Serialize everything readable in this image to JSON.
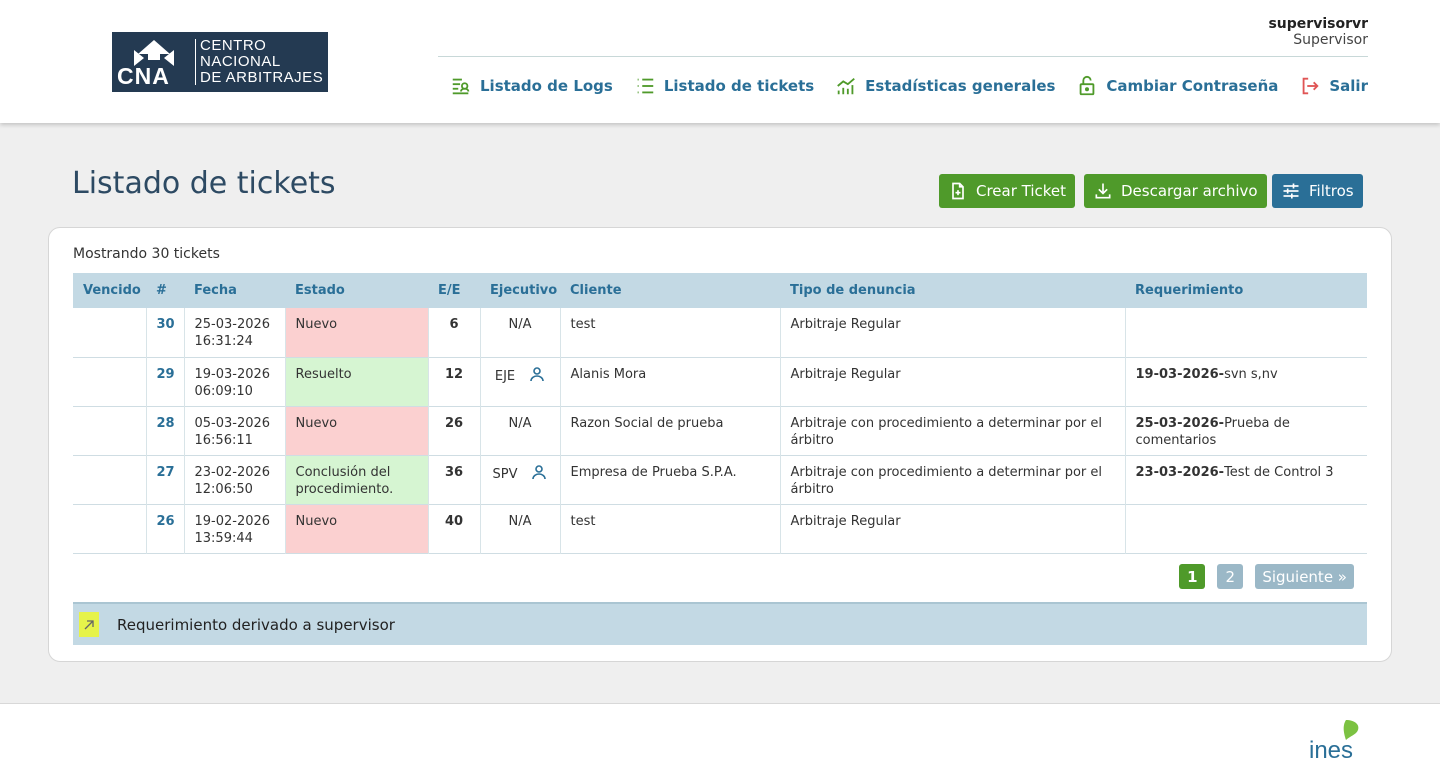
{
  "header": {
    "logo": {
      "cna": "CNA",
      "line1": "CENTRO",
      "line2": "NACIONAL",
      "line3": "DE ARBITRAJES"
    },
    "user": {
      "name": "supervisorvr",
      "role": "Supervisor"
    },
    "nav": [
      {
        "label": "Listado de Logs",
        "icon": "logs-icon"
      },
      {
        "label": "Listado de tickets",
        "icon": "list-icon"
      },
      {
        "label": "Estadísticas generales",
        "icon": "chart-icon"
      },
      {
        "label": "Cambiar Contraseña",
        "icon": "lock-icon"
      },
      {
        "label": "Salir",
        "icon": "logout-icon"
      }
    ]
  },
  "main": {
    "title": "Listado de tickets",
    "buttons": {
      "create": "Crear Ticket",
      "download": "Descargar archivo",
      "filters": "Filtros"
    },
    "count_text": "Mostrando 30 tickets",
    "columns": [
      "Vencido",
      "#",
      "Fecha",
      "Estado",
      "E/E",
      "Ejecutivo",
      "Cliente",
      "Tipo de denuncia",
      "Requerimiento"
    ],
    "rows": [
      {
        "vencido": "",
        "num": "30",
        "fecha1": "25-03-2026",
        "fecha2": "16:31:24",
        "estado": "Nuevo",
        "ee": "6",
        "ejecutivo": "N/A",
        "cliente": "test",
        "tipo": "Arbitraje Regular",
        "req_date": "",
        "req_text": ""
      },
      {
        "vencido": "",
        "num": "29",
        "fecha1": "19-03-2026",
        "fecha2": "06:09:10",
        "estado": "Resuelto",
        "ee": "12",
        "ejecutivo": "EJE",
        "cliente": "Alanis Mora",
        "tipo": "Arbitraje Regular",
        "req_date": "19-03-2026-",
        "req_text": "svn s,nv"
      },
      {
        "vencido": "",
        "num": "28",
        "fecha1": "05-03-2026",
        "fecha2": "16:56:11",
        "estado": "Nuevo",
        "ee": "26",
        "ejecutivo": "N/A",
        "cliente": "Razon Social de prueba",
        "tipo": "Arbitraje con procedimiento a determinar por el árbitro",
        "req_date": "25-03-2026-",
        "req_text": "Prueba de comentarios"
      },
      {
        "vencido": "",
        "num": "27",
        "fecha1": "23-02-2026",
        "fecha2": "12:06:50",
        "estado": "Conclusión del procedimiento.",
        "ee": "36",
        "ejecutivo": "SPV",
        "cliente": "Empresa de Prueba S.P.A.",
        "tipo": "Arbitraje con procedimiento a determinar por el árbitro",
        "req_date": "23-03-2026-",
        "req_text": "Test de Control 3"
      },
      {
        "vencido": "",
        "num": "26",
        "fecha1": "19-02-2026",
        "fecha2": "13:59:44",
        "estado": "Nuevo",
        "ee": "40",
        "ejecutivo": "N/A",
        "cliente": "test",
        "tipo": "Arbitraje Regular",
        "req_date": "",
        "req_text": ""
      }
    ],
    "pagination": {
      "page1": "1",
      "page2": "2",
      "next": "Siguiente »"
    },
    "legend": "Requerimiento derivado a supervisor"
  },
  "footer": {
    "brand": "ines"
  },
  "colors": {
    "primary_blue": "#2a6f97",
    "green": "#4f9a2a",
    "status_red": "#fbd0d0",
    "status_green": "#d6f5d2",
    "legend_yellow": "#e6f34a"
  }
}
